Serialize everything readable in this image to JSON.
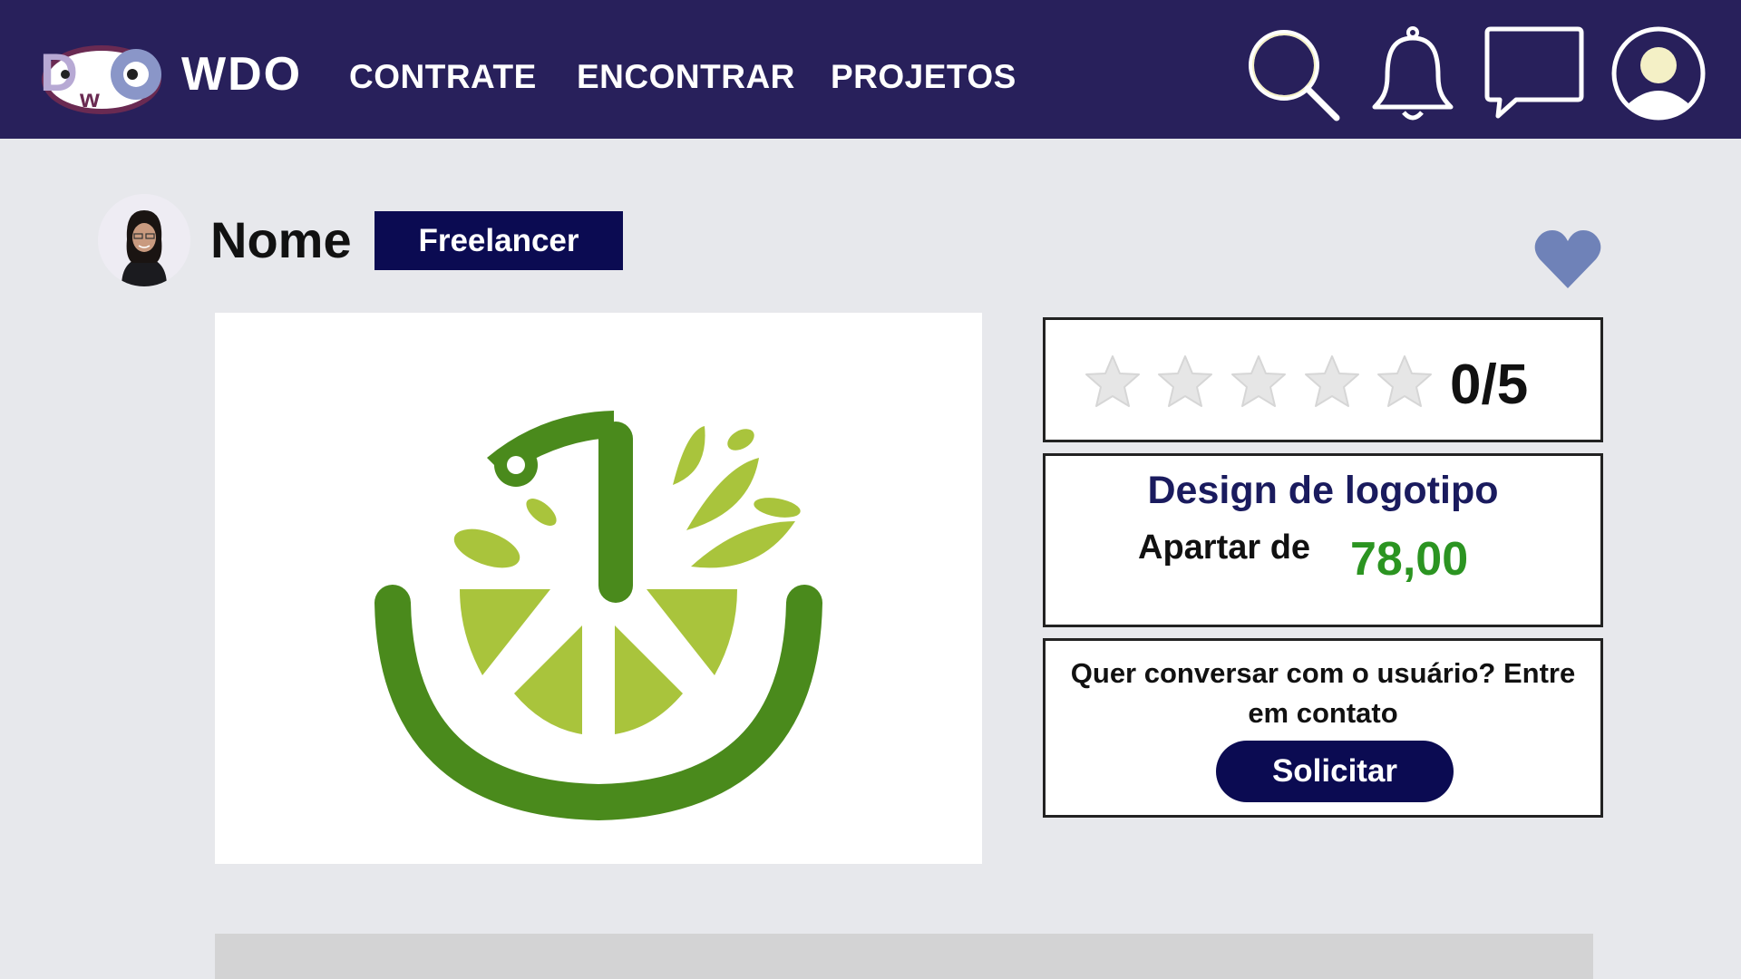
{
  "header": {
    "brand": "WDO",
    "nav": [
      "CONTRATE",
      "ENCONTRAR",
      "PROJETOS"
    ],
    "icons": [
      "search-icon",
      "bell-icon",
      "chat-icon",
      "user-icon"
    ],
    "background": "#28205b"
  },
  "profile": {
    "name": "Nome",
    "role_badge": "Freelancer"
  },
  "rating": {
    "stars_filled": 0,
    "stars_total": 5,
    "text": "0/5"
  },
  "service": {
    "title": "Design de logotipo",
    "price_label": "Apartar de",
    "price_value": "78,00"
  },
  "contact": {
    "prompt": "Quer conversar com o usuário? Entre em contato",
    "button": "Solicitar"
  },
  "colors": {
    "accent_navy": "#0b0b52",
    "price_green": "#2b9421",
    "heart": "#6f82b8",
    "lime_dark": "#4a8a1c",
    "lime_light": "#a9c43c"
  }
}
